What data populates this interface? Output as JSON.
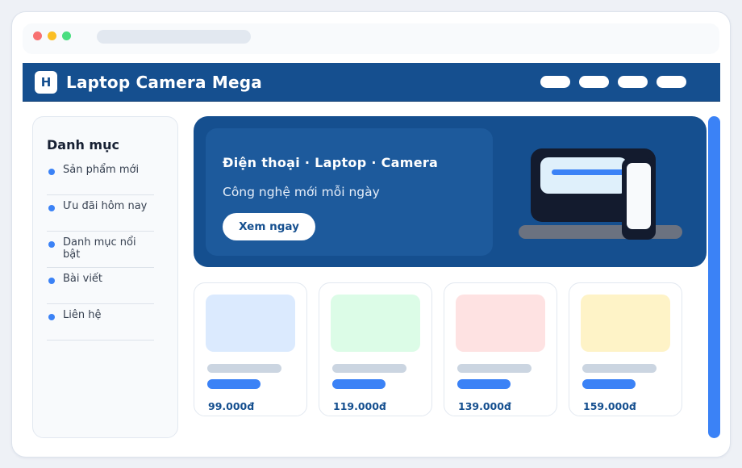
{
  "header": {
    "logo_letter": "H",
    "brand": "Laptop Camera Mega"
  },
  "sidebar": {
    "title": "Danh mục",
    "items": [
      {
        "label": "Sản phẩm mới"
      },
      {
        "label": "Ưu đãi hôm nay"
      },
      {
        "label": "Danh mục nổi bật"
      },
      {
        "label": "Bài viết"
      },
      {
        "label": "Liên hệ"
      }
    ]
  },
  "hero": {
    "title": "Điện thoại · Laptop · Camera",
    "subtitle": "Công nghệ mới mỗi ngày",
    "cta_label": "Xem ngay"
  },
  "products": [
    {
      "price": "99.000đ",
      "thumb_color": "#dbeafe"
    },
    {
      "price": "119.000đ",
      "thumb_color": "#dcfce7"
    },
    {
      "price": "139.000đ",
      "thumb_color": "#fee2e2"
    },
    {
      "price": "159.000đ",
      "thumb_color": "#fef3c7"
    }
  ],
  "colors": {
    "primary": "#154f8f",
    "accent": "#3b82f6"
  }
}
